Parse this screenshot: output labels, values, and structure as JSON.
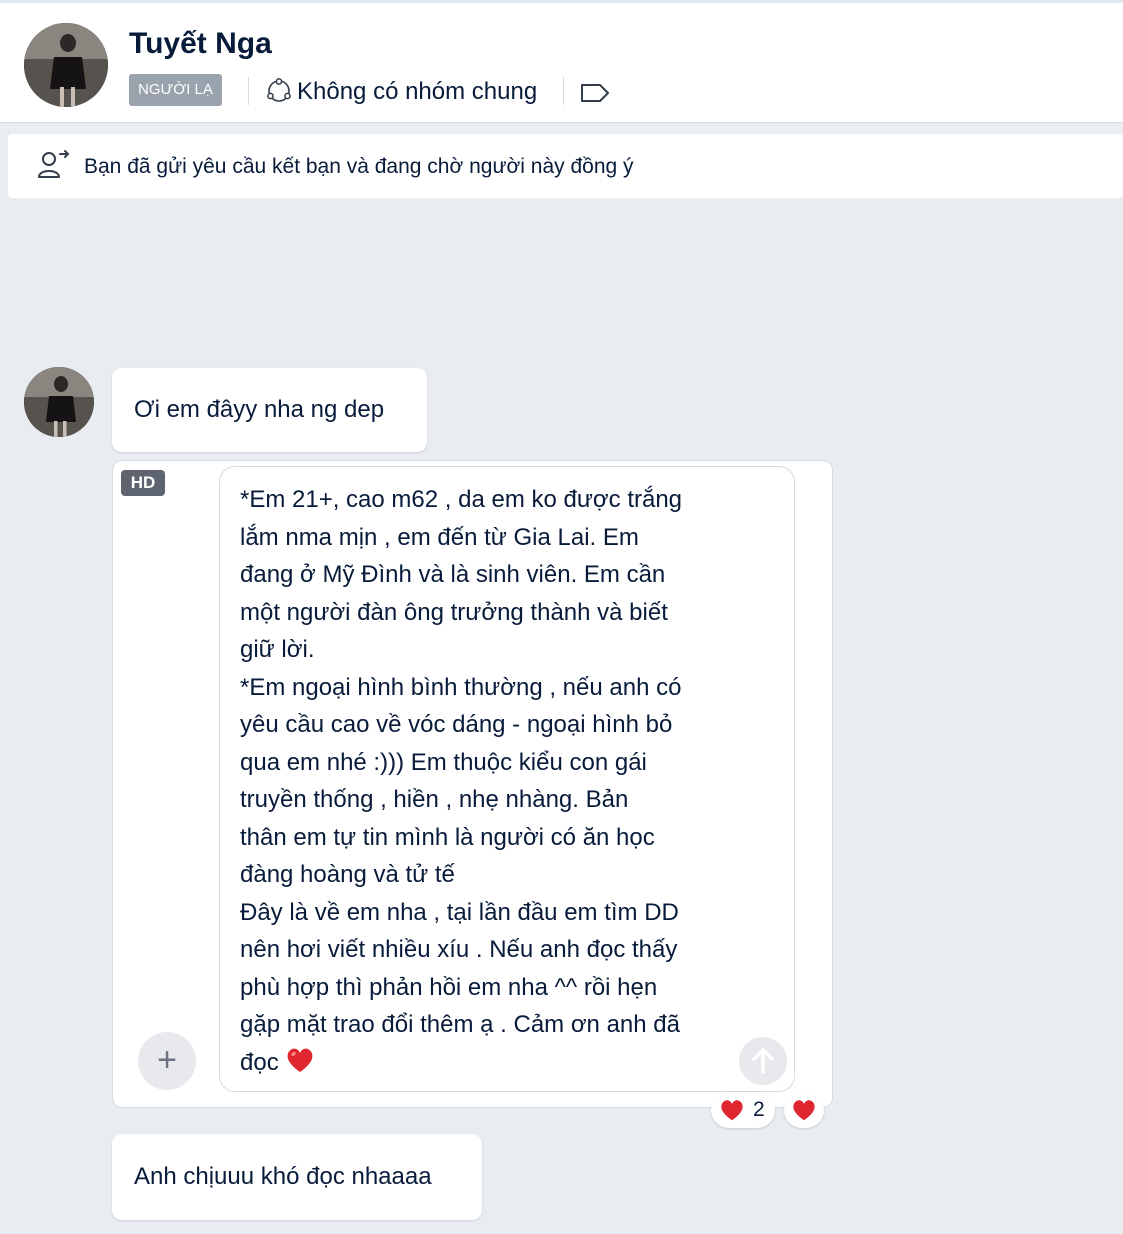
{
  "header": {
    "contact_name": "Tuyết Nga",
    "stranger_tag": "NGƯỜI LẠ",
    "group_status": "Không có nhóm chung"
  },
  "notice": {
    "text": "Bạn đã gửi yêu cầu kết bạn và đang chờ người này đồng ý"
  },
  "messages": [
    {
      "text": "Ơi em đâyy nha ng dep"
    },
    {
      "badge": "HD",
      "lines": [
        "*Em 21+, cao m62 , da em ko được trắng",
        "lắm nma mịn , em đến từ Gia Lai. Em",
        "đang ở Mỹ Đình và là sinh viên. Em cần",
        "một người đàn ông trưởng thành và biết",
        "giữ lời.",
        "*Em ngoại hình bình thường , nếu anh có",
        "yêu cầu cao về vóc dáng - ngoại hình bỏ",
        "qua em nhé :))) Em thuộc kiểu con gái",
        "truyền thống , hiền , nhẹ nhàng. Bản",
        "thân em tự tin mình là người có ăn học",
        "đàng hoàng và tử tế",
        "Đây là về em nha , tại lần đầu em tìm DD",
        "nên hơi viết nhiều xíu . Nếu anh đọc thấy",
        "phù hợp thì phản hồi em nha ^^ rồi hẹn",
        "gặp mặt trao đổi thêm ạ . Cảm ơn anh đã",
        "đọc"
      ],
      "reaction_count": "2"
    },
    {
      "text": "Anh chịuuu khó đọc nhaaaa"
    }
  ],
  "colors": {
    "background": "#e9ecf1",
    "text": "#081b3a",
    "tag": "#9aa2ad",
    "heart": "#e0262f"
  }
}
